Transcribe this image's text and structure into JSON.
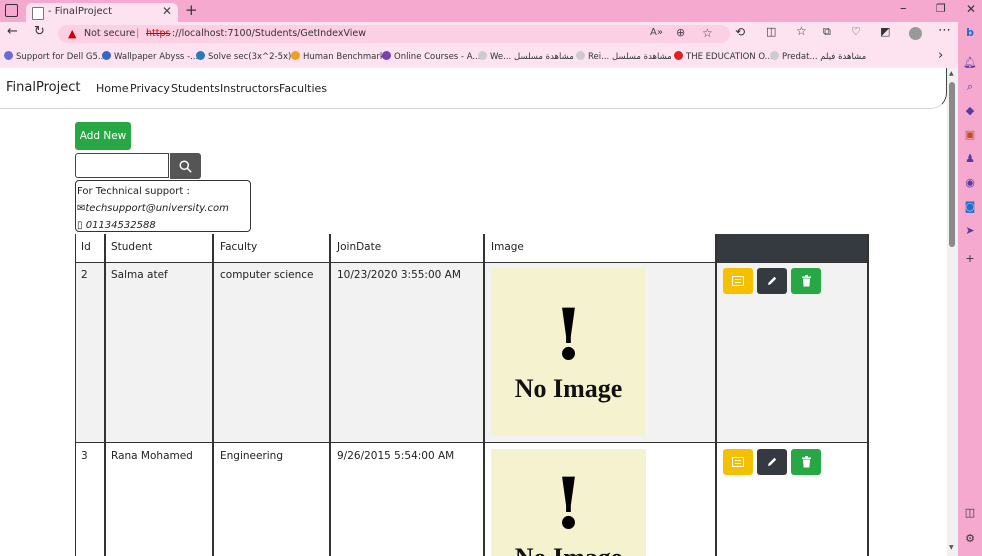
{
  "browser": {
    "tab_title": "- FinalProject",
    "not_secure_label": "Not secure",
    "url_scheme": "https",
    "url_rest": "://localhost:7100/Students/GetIndexView",
    "bookmarks": [
      {
        "label": "Support for Dell G5...",
        "color": "#6b6bd6"
      },
      {
        "label": "Wallpaper Abyss -...",
        "color": "#3366cc"
      },
      {
        "label": "Solve sec(3x^2-5x)...",
        "color": "#2a7abf"
      },
      {
        "label": "Human Benchmark",
        "color": "#f0a020"
      },
      {
        "label": "Online Courses - A...",
        "color": "#7a3fb0"
      },
      {
        "label": "We... مشاهدة مسلسل",
        "color": "#cccccc"
      },
      {
        "label": "Rei... مشاهدة مسلسل",
        "color": "#cccccc"
      },
      {
        "label": "THE EDUCATION O...",
        "color": "#e02020"
      },
      {
        "label": "Predat... مشاهدة فيلم",
        "color": "#cccccc"
      }
    ]
  },
  "navbar": {
    "brand": "FinalProject",
    "links": [
      "Home",
      "Privacy",
      "Students",
      "Instructors",
      "Faculties"
    ]
  },
  "page": {
    "add_new_label": "Add New",
    "search_placeholder": "",
    "support": {
      "title": "For Technical support :",
      "email": "techsupport@university.com",
      "phone": "01134532588"
    }
  },
  "table": {
    "headers": [
      "Id",
      "Student",
      "Faculty",
      "JoinDate",
      "Image",
      ""
    ],
    "rows": [
      {
        "id": "2",
        "student": "Salma atef",
        "faculty": "computer science",
        "join_date": "10/23/2020 3:55:00 AM",
        "image_text": "No Image"
      },
      {
        "id": "3",
        "student": "Rana Mohamed",
        "faculty": "Engineering",
        "join_date": "9/26/2015 5:54:00 AM",
        "image_text": "No Image"
      }
    ]
  },
  "colors": {
    "add_button": "#28a745",
    "details_button": "#f5c000",
    "edit_button": "#343a40",
    "delete_button": "#28a745",
    "browser_chrome": "#f6a9cf"
  }
}
